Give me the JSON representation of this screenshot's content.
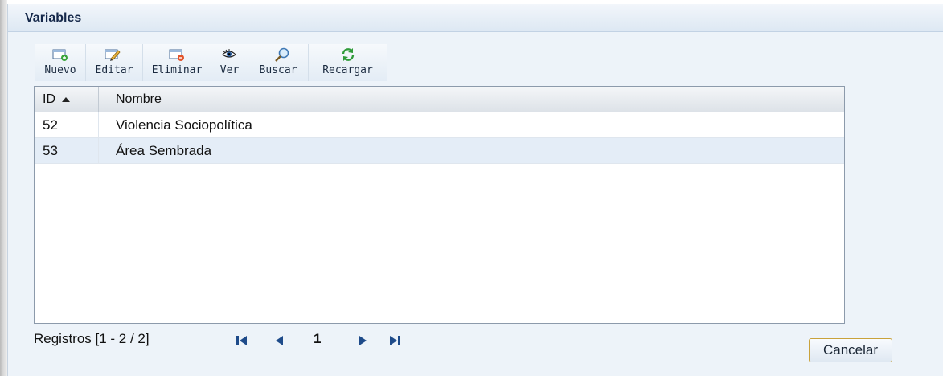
{
  "panel": {
    "title": "Variables"
  },
  "toolbar": {
    "buttons": [
      {
        "label": "Nuevo",
        "icon": "new-window-icon"
      },
      {
        "label": "Editar",
        "icon": "edit-pencil-icon"
      },
      {
        "label": "Eliminar",
        "icon": "delete-window-icon"
      },
      {
        "label": "Ver",
        "icon": "eye-icon"
      },
      {
        "label": "Buscar",
        "icon": "magnifier-icon"
      },
      {
        "label": "Recargar",
        "icon": "refresh-icon"
      }
    ]
  },
  "grid": {
    "columns": [
      "ID",
      "Nombre"
    ],
    "sort": {
      "column": "ID",
      "direction": "ascending"
    },
    "rows": [
      {
        "id": "52",
        "nombre": "Violencia Sociopolítica"
      },
      {
        "id": "53",
        "nombre": "Área Sembrada"
      }
    ]
  },
  "pager": {
    "info": "Registros [1 - 2 / 2]",
    "current_page": "1"
  },
  "footer": {
    "cancel_label": "Cancelar"
  },
  "colors": {
    "panel_background": "#edf3f9",
    "header_text": "#15284a",
    "selected_row": "#e4edf7",
    "pager_icons": "#1e4b8a",
    "cancel_border": "#c9a23b"
  }
}
